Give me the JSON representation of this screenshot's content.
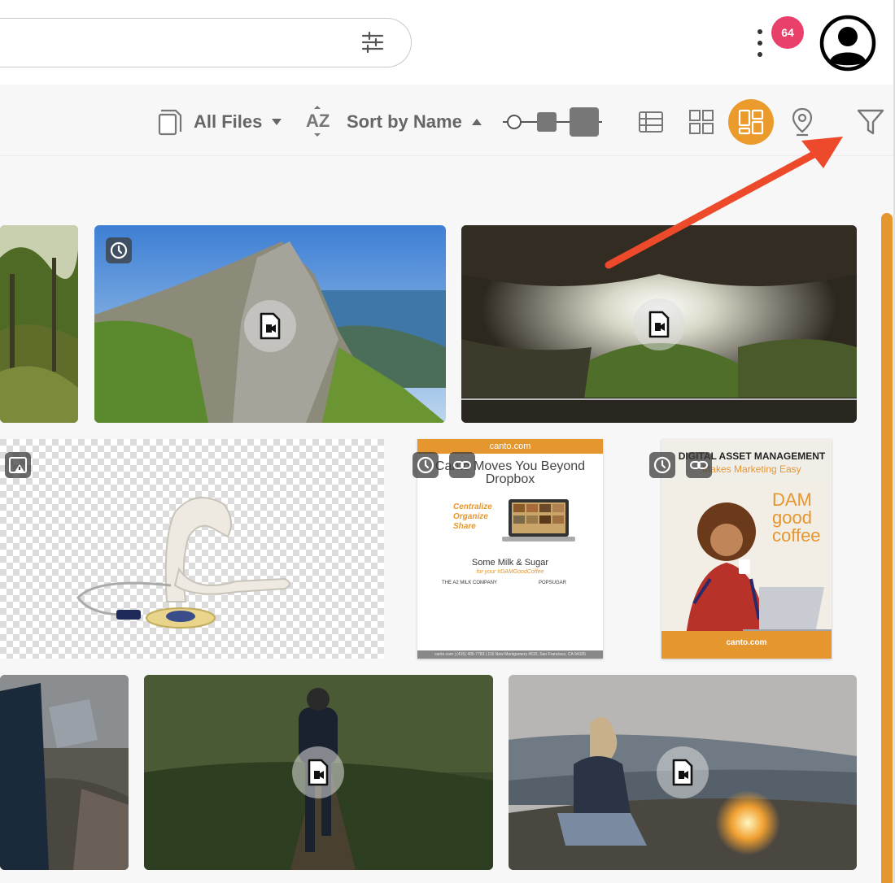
{
  "topbar": {
    "search": {
      "value": "",
      "placeholder": ""
    },
    "search_options_icon": "tune-icon",
    "more_icon": "kebab-menu-icon",
    "notifications": {
      "count": "64",
      "color": "#e8406a"
    },
    "avatar_icon": "account-circle-icon"
  },
  "toolbar": {
    "file_type": {
      "label": "All Files",
      "icon": "files-icon"
    },
    "sort": {
      "label": "Sort by Name",
      "icon": "sort-az-icon",
      "az_label": "AZ"
    },
    "thumbnail_size_icon": "size-slider-icon",
    "views": [
      {
        "name": "list",
        "icon": "list-view-icon",
        "active": false
      },
      {
        "name": "grid",
        "icon": "grid-view-icon",
        "active": false
      },
      {
        "name": "masonry",
        "icon": "masonry-view-icon",
        "active": true
      },
      {
        "name": "map",
        "icon": "location-pin-icon",
        "active": false
      }
    ],
    "filter_icon": "filter-icon",
    "accent": "#eb9b2c"
  },
  "assets": {
    "doc1": {
      "header": "canto.com",
      "title": "Canto Moves You Beyond Dropbox",
      "list": [
        "Centralize",
        "Organize",
        "Share"
      ],
      "subtitle": "Some Milk & Sugar",
      "tag": "for your #DAMGoodCoffee",
      "col1": "THE A2 MILK COMPANY",
      "col2": "POPSUGAR",
      "footer": "canto.com | (415) 495-7783 | 116 New Montgomery #515, San Francisco, CA 94105"
    },
    "doc2": {
      "title": "DIGITAL ASSET MANAGEMENT",
      "subtitle": "Makes Marketing Easy",
      "dam": [
        "DAM",
        "good",
        "coffee"
      ],
      "footer": "canto.com"
    }
  }
}
